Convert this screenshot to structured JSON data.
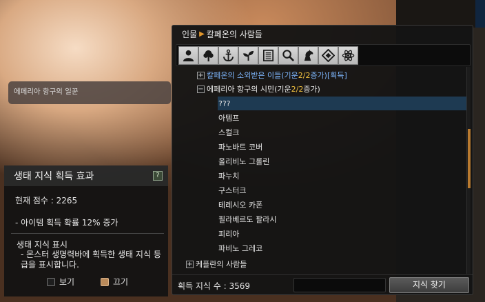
{
  "tooltip": {
    "text": "에페리아 항구의 일꾼"
  },
  "effect_panel": {
    "title": "생태 지식 획득 효과",
    "help": "?",
    "score": "현재 점수 : 2265",
    "bonus": "- 아이템 획득 확률 12% 증가",
    "display_title": "생태 지식 표시",
    "display_desc": "- 몬스터 생명력바에 획득한 생태 지식 등급을 표시합니다.",
    "option_show": "보기",
    "option_hide": "끄기",
    "selected_option": "끄기"
  },
  "knowledge": {
    "breadcrumb_root": "인물",
    "breadcrumb_current": "칼페온의 사람들",
    "toolbar_icons": [
      "person-icon",
      "tree-icon",
      "anchor-icon",
      "sprout-icon",
      "book-icon",
      "magnifier-icon",
      "horse-icon",
      "diamond-icon",
      "atom-icon"
    ],
    "groups": [
      {
        "toggle": "+",
        "prefix": "칼페온의 소외받은 이들(기운 ",
        "count": "2/2",
        "suffix": " 증가)[획득]",
        "style": "blue"
      },
      {
        "toggle": "−",
        "prefix": "에페리아 항구의 시민(기운 ",
        "count": "2/2",
        "suffix": " 증가)",
        "style": "white"
      }
    ],
    "items": [
      "???",
      "아템프",
      "스컬크",
      "파노바트 코버",
      "올리비노 그롤린",
      "파누치",
      "구스터크",
      "테레시오 카폰",
      "필라베르도 팔라시",
      "피리아",
      "파비노 그레코"
    ],
    "selected_item": "???",
    "next_group": {
      "toggle": "+",
      "label": "케플란의 사람들"
    },
    "footer_count": "획득 지식 수 : 3569",
    "search_button": "지식 찾기",
    "search_value": ""
  },
  "colors": {
    "accent": "#b97a2f",
    "group_blue": "#7fb8ff",
    "count_yellow": "#f0c040",
    "selection": "#1e3a52"
  }
}
